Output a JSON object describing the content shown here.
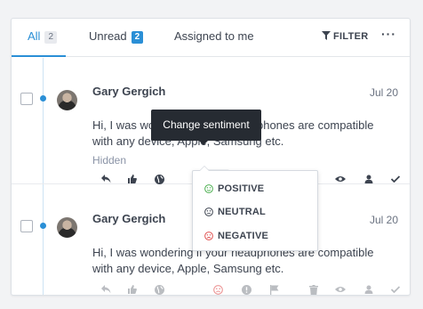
{
  "tabs": [
    {
      "label": "All",
      "count": "2"
    },
    {
      "label": "Unread",
      "count": "2"
    },
    {
      "label": "Assigned to me"
    }
  ],
  "toolbar": {
    "filter_label": "FILTER",
    "more_label": "···"
  },
  "messages": [
    {
      "author": "Gary Gergich",
      "date": "Jul 20",
      "text": "Hi, I was wondering if your headphones are compatible with any device, Apple, Samsung etc.",
      "status": "Hidden"
    },
    {
      "author": "Gary Gergich",
      "date": "Jul 20",
      "text": "Hi, I was wondering if your headphones are compatible with any device, Apple, Samsung etc."
    }
  ],
  "tooltip": "Change sentiment",
  "sentiment_menu": [
    {
      "label": "POSITIVE",
      "color": "#4caf50"
    },
    {
      "label": "NEUTRAL",
      "color": "#3d4450"
    },
    {
      "label": "NEGATIVE",
      "color": "#e05252"
    }
  ],
  "colors": {
    "accent": "#2a8fd6",
    "negative": "#e05252",
    "positive": "#4caf50"
  },
  "action_icons": [
    "reply-icon",
    "like-icon",
    "globe-icon",
    "sentiment-icon",
    "alert-icon",
    "flag-icon",
    "trash-icon",
    "eye-icon",
    "user-icon",
    "check-icon"
  ]
}
